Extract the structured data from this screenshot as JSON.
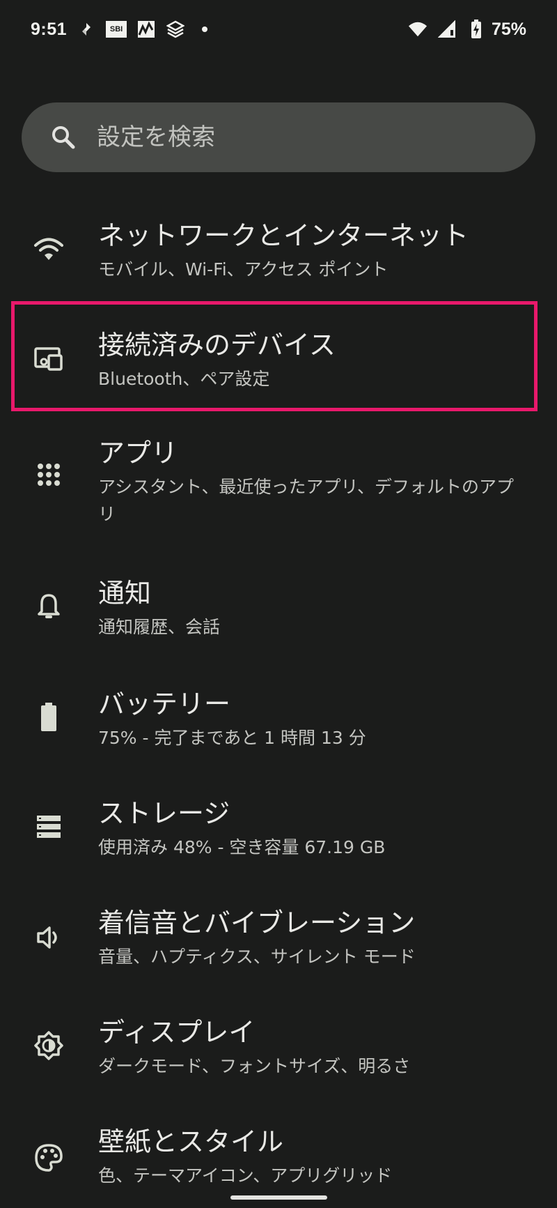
{
  "status_bar": {
    "time": "9:51",
    "sbi_label": "SBI",
    "battery_percent": "75%",
    "icons_left": [
      "sync-icon",
      "sbi-app-icon",
      "chart-app-icon",
      "layers-app-icon",
      "notification-dot-icon"
    ],
    "icons_right": [
      "wifi-icon",
      "cell-signal-icon",
      "battery-charging-icon"
    ]
  },
  "search": {
    "placeholder": "設定を検索"
  },
  "settings": {
    "items": [
      {
        "icon": "wifi-icon",
        "title": "ネットワークとインターネット",
        "summary": "モバイル、Wi-Fi、アクセス ポイント"
      },
      {
        "icon": "devices-icon",
        "title": "接続済みのデバイス",
        "summary": "Bluetooth、ペア設定"
      },
      {
        "icon": "apps-grid-icon",
        "title": "アプリ",
        "summary": "アシスタント、最近使ったアプリ、デフォルトのアプリ"
      },
      {
        "icon": "bell-icon",
        "title": "通知",
        "summary": "通知履歴、会話"
      },
      {
        "icon": "battery-icon",
        "title": "バッテリー",
        "summary": "75% - 完了まであと 1 時間 13 分"
      },
      {
        "icon": "storage-icon",
        "title": "ストレージ",
        "summary": "使用済み 48% - 空き容量 67.19 GB"
      },
      {
        "icon": "volume-icon",
        "title": "着信音とバイブレーション",
        "summary": "音量、ハプティクス、サイレント モード"
      },
      {
        "icon": "brightness-icon",
        "title": "ディスプレイ",
        "summary": "ダークモード、フォントサイズ、明るさ"
      },
      {
        "icon": "palette-icon",
        "title": "壁紙とスタイル",
        "summary": "色、テーマアイコン、アプリグリッド"
      }
    ]
  },
  "colors": {
    "background": "#1b1c1b",
    "search_bg": "#474946",
    "highlight": "#e8196b",
    "icon": "#d9dcd2"
  }
}
